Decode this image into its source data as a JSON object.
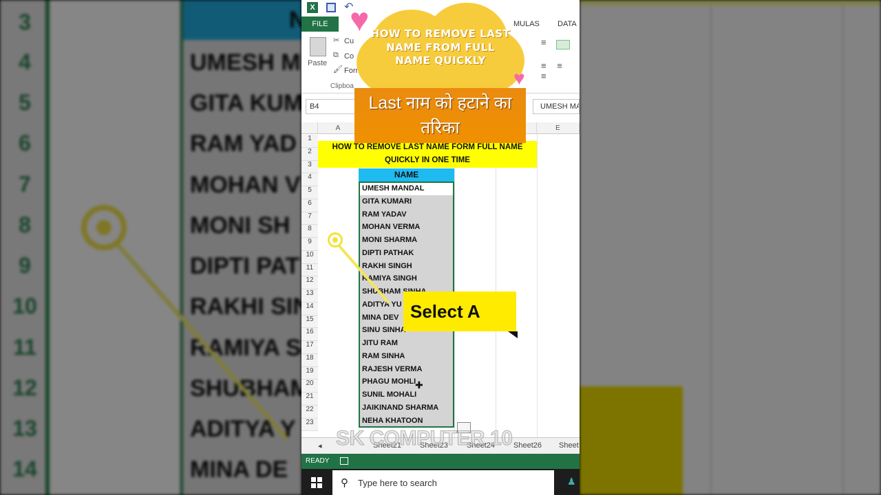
{
  "excel": {
    "app_icon": "X",
    "tabs": {
      "file": "FILE",
      "formulas": "MULAS",
      "data": "DATA"
    },
    "ribbon": {
      "paste": "Paste",
      "cut": "Cu",
      "copy": "Co",
      "format_painter": "Form",
      "clipboard": "Clipboa"
    },
    "name_box": "B4",
    "formula_value": "UMESH MA",
    "columns": [
      "A",
      "E"
    ],
    "rows": [
      "1",
      "2",
      "3",
      "4",
      "5",
      "6",
      "7",
      "8",
      "9",
      "10",
      "11",
      "12",
      "13",
      "14",
      "15",
      "16",
      "17",
      "18",
      "19",
      "20",
      "21",
      "22",
      "23"
    ],
    "title_cell": "HOW TO REMOVE LAST NAME FORM FULL NAME QUICKLY IN ONE TIME",
    "name_header": "NAME",
    "names": [
      "UMESH MANDAL",
      "GITA KUMARI",
      "RAM YADAV",
      "MOHAN VERMA",
      "MONI SHARMA",
      "DIPTI PATHAK",
      "RAKHI SINGH",
      "RAMIYA SINGH",
      "SHUBHAM SINHA",
      "ADITYA YU",
      "MINA DEV",
      "SINU SINHA",
      "JITU RAM",
      "RAM SINHA",
      "RAJESH VERMA",
      "PHAGU MOHLI",
      "SUNIL MOHALI",
      "JAIKINAND SHARMA",
      "NEHA KHATOON"
    ],
    "sheet_tabs": [
      "Sheet21",
      "Sheet23",
      "Sheet24",
      "Sheet26",
      "Sheet"
    ],
    "status": "READY"
  },
  "taskbar": {
    "search_placeholder": "Type here to search"
  },
  "overlay": {
    "cloud_title": "HOW TO REMOVE LAST NAME FROM FULL NAME QUICKLY",
    "hindi_caption": "Last नाम को हटाने का तरिका",
    "callout": "Select A",
    "watermark": "SK COMPUTER 10"
  },
  "background": {
    "row_numbers": [
      "3",
      "4",
      "5",
      "6",
      "7",
      "8",
      "9",
      "10",
      "11",
      "12",
      "13",
      "14"
    ],
    "names": [
      "UMESH M",
      "GITA KUM",
      "RAM YAD",
      "MOHAN V",
      "MONI SH",
      "DIPTI PAT",
      "RAKHI SIN",
      "RAMIYA S",
      "SHUBHAM",
      "ADITYA Y",
      "MINA DE"
    ],
    "header_fragment": "N"
  },
  "colors": {
    "excel_green": "#217346",
    "name_header": "#1ebbf0",
    "title_fill": "#ffff00",
    "cloud": "#f7cc3c",
    "caption_bg": "#f09000"
  }
}
